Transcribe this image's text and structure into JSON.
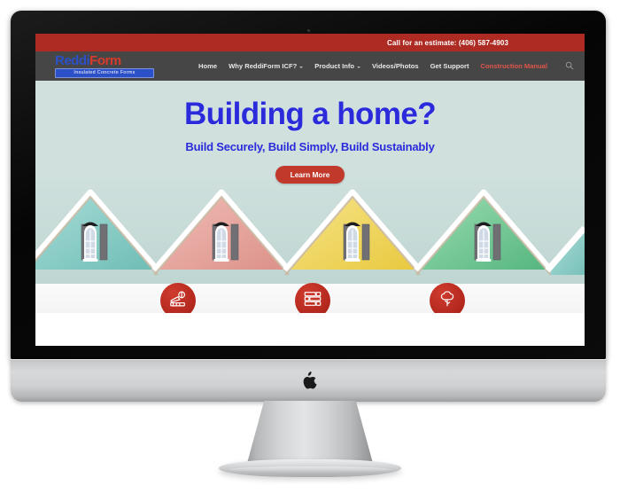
{
  "device": {
    "type": "imac-desktop-computer",
    "brand_logo": "apple-logo",
    "webcam": "webcam-dot",
    "bezel_color": "#0a0a0a",
    "chin_color": "#d6d8da"
  },
  "site": {
    "topbar": {
      "phone_label": "Call for an estimate: (406) 587-4903",
      "background": "#ad2b22"
    },
    "logo": {
      "part_one": "Reddi",
      "part_two": "Form",
      "tagline": "Insulated Concrete Forms",
      "blue": "#2b50c8",
      "red": "#d83a2c"
    },
    "nav": {
      "items": [
        {
          "label": "Home",
          "has_caret": false,
          "accent": false
        },
        {
          "label": "Why ReddiForm ICF?",
          "has_caret": true,
          "accent": false
        },
        {
          "label": "Product Info",
          "has_caret": true,
          "accent": false
        },
        {
          "label": "Videos/Photos",
          "has_caret": false,
          "accent": false
        },
        {
          "label": "Get Support",
          "has_caret": false,
          "accent": false
        },
        {
          "label": "Construction Manual",
          "has_caret": false,
          "accent": true
        }
      ],
      "search_icon": "search-icon",
      "background": "#464646",
      "accent_color": "#e0554a"
    },
    "hero": {
      "headline": "Building a home?",
      "subheadline": "Build Securely, Build Simply, Build Sustainably",
      "cta_label": "Learn More",
      "cta_color": "#c0392b",
      "text_color": "#2b2bdc",
      "background": "#cfe0dd",
      "houses": [
        {
          "name": "house-teal",
          "color": "#8ecfc9"
        },
        {
          "name": "house-pink",
          "color": "#e7a7a0"
        },
        {
          "name": "house-yellow",
          "color": "#f0d757"
        },
        {
          "name": "house-green",
          "color": "#72c894"
        }
      ]
    },
    "feature_badges": [
      {
        "icon": "excavator-icon",
        "color": "#bc2a1f"
      },
      {
        "icon": "block-wall-icon",
        "color": "#bc2a1f"
      },
      {
        "icon": "tree-eco-icon",
        "color": "#bc2a1f"
      }
    ]
  }
}
